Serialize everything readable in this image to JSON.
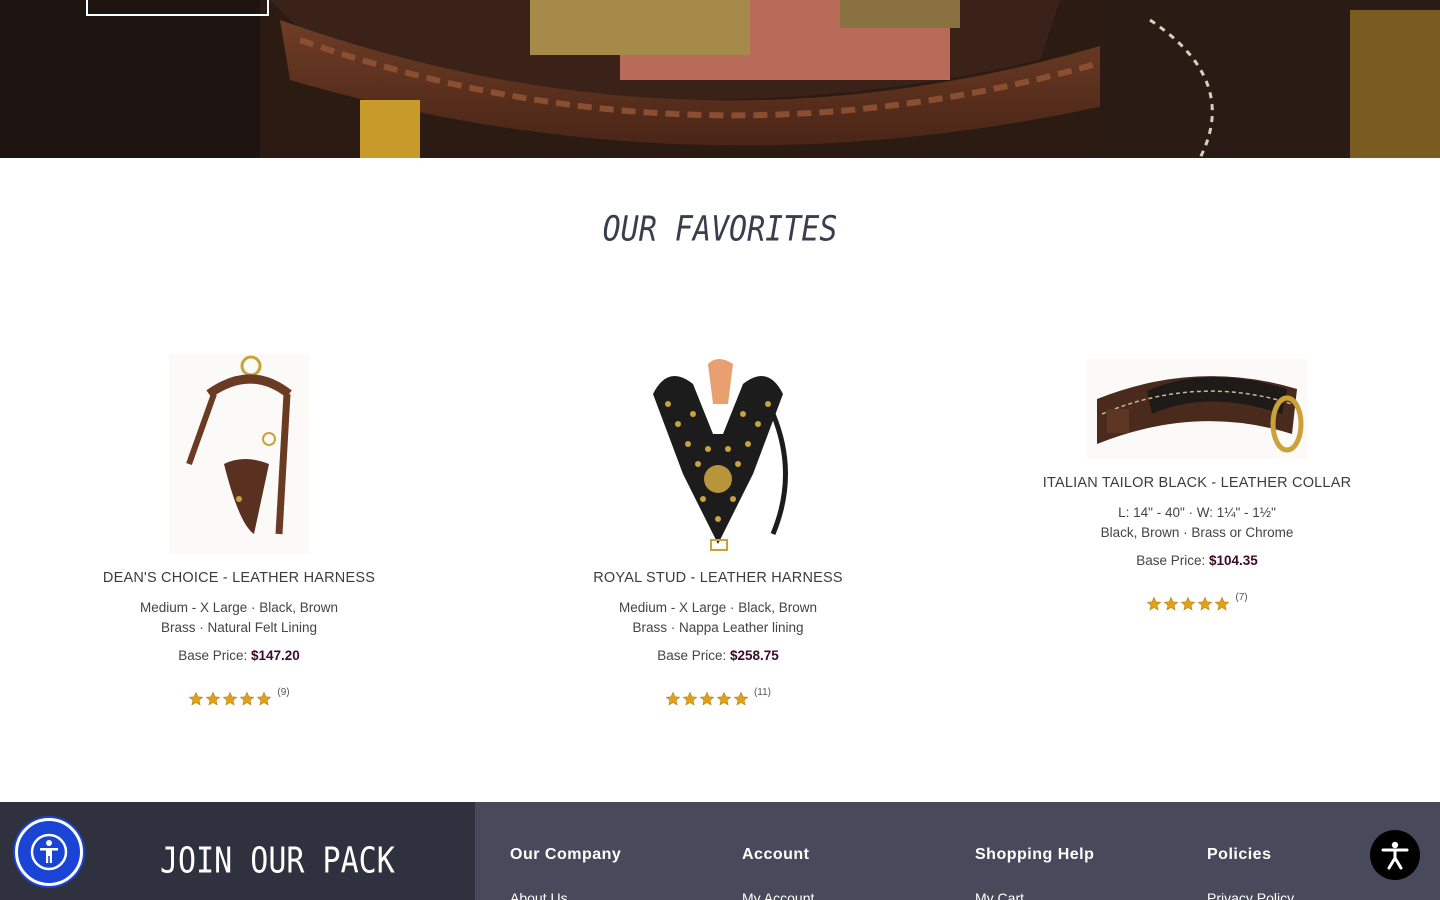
{
  "hero": {
    "button_label": ""
  },
  "favorites": {
    "title": "OUR FAVORITES",
    "price_label": "Base Price:",
    "products": [
      {
        "name": "DEAN'S CHOICE - LEATHER HARNESS",
        "spec_line_1": "Medium - X Large · Black, Brown",
        "spec_line_2": "Brass · Natural Felt Lining",
        "price": "$147.20",
        "rating": 5,
        "review_count": "(9)",
        "image": "brown-leather-harness-image"
      },
      {
        "name": "ROYAL STUD - LEATHER HARNESS",
        "spec_line_1": "Medium - X Large · Black, Brown",
        "spec_line_2": "Brass · Nappa Leather lining",
        "price": "$258.75",
        "rating": 5,
        "review_count": "(11)",
        "image": "studded-black-harness-image"
      },
      {
        "name": "ITALIAN TAILOR BLACK - LEATHER COLLAR",
        "spec_line_1": "L: 14\" - 40\" · W: 1¼\" - 1½\"",
        "spec_line_2": "Black, Brown · Brass or Chrome",
        "price": "$104.35",
        "rating": 5,
        "review_count": "(7)",
        "image": "brown-leather-collar-image"
      }
    ]
  },
  "footer": {
    "join_title": "JOIN OUR PACK",
    "columns": [
      {
        "heading": "Our Company",
        "first_link": "About Us"
      },
      {
        "heading": "Account",
        "first_link": "My Account"
      },
      {
        "heading": "Shopping Help",
        "first_link": "My Cart"
      },
      {
        "heading": "Policies",
        "first_link": "Privacy Policy"
      }
    ]
  },
  "colors": {
    "price": "#3d0a2e",
    "star": "#e0a018",
    "footer_dark": "#30313f",
    "footer_light": "#484a5c",
    "a11y_blue": "#1a44d6"
  },
  "icons": {
    "accessibility_left": "accessibility-person-icon",
    "accessibility_right": "accessibility-figure-icon",
    "star": "star-icon"
  }
}
